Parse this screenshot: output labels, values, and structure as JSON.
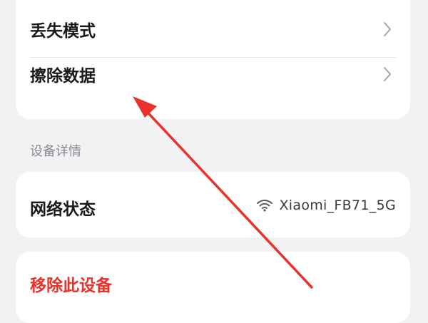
{
  "security": {
    "items": [
      {
        "label": "丢失模式"
      },
      {
        "label": "擦除数据"
      }
    ]
  },
  "details": {
    "section_title": "设备详情",
    "network": {
      "label": "网络状态",
      "value": "Xiaomi_FB71_5G",
      "icon": "wifi-icon"
    }
  },
  "actions": {
    "remove_label": "移除此设备"
  },
  "colors": {
    "background": "#f2f2f5",
    "card": "#ffffff",
    "danger": "#e8322b",
    "arrow": "#e8322b",
    "chevron": "#a6a6aa"
  }
}
